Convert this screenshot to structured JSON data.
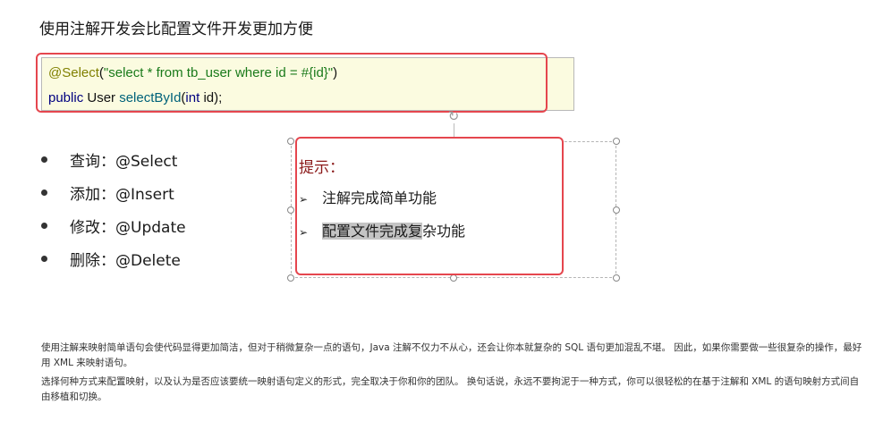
{
  "title": "使用注解开发会比配置文件开发更加方便",
  "code": {
    "line1": {
      "annotation": "@Select",
      "open": "(",
      "string": "\"select * from tb_user where id = #{id}\"",
      "close": ")"
    },
    "line2": {
      "kw_public": "public",
      "type": "User",
      "method": "selectById",
      "open": "(",
      "kw_int": "int",
      "rest": "id);"
    }
  },
  "bullets": [
    {
      "label": "查询：@Select"
    },
    {
      "label": "添加：@Insert"
    },
    {
      "label": "修改：@Update"
    },
    {
      "label": "删除：@Delete"
    }
  ],
  "tip": {
    "title": "提示：",
    "items": [
      {
        "text": "注解完成简单功能"
      },
      {
        "highlight": "配置文件完成复",
        "rest": "杂功能"
      }
    ],
    "arrow": "➢"
  },
  "notes": [
    "使用注解来映射简单语句会使代码显得更加简洁，但对于稍微复杂一点的语句，Java 注解不仅力不从心，还会让你本就复杂的 SQL 语句更加混乱不堪。 因此，如果你需要做一些很复杂的操作，最好用 XML 来映射语句。",
    "选择何种方式来配置映射，以及认为是否应该要统一映射语句定义的形式，完全取决于你和你的团队。 换句话说，永远不要拘泥于一种方式，你可以很轻松的在基于注解和 XML 的语句映射方式间自由移植和切换。"
  ],
  "icons": {
    "rotate": "↻"
  }
}
